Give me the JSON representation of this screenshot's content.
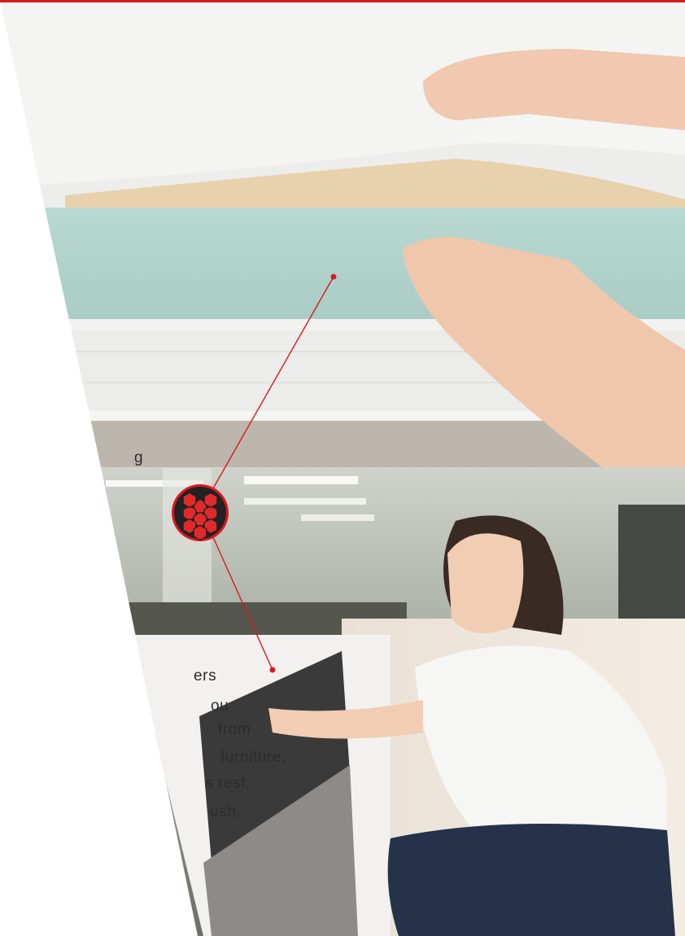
{
  "article": {
    "fragment_top": "g",
    "lines": [
      "ers",
      "ou",
      "from",
      "furniture.",
      "s rest,",
      "ush,"
    ]
  },
  "icons": {
    "callout_badge": "honeycomb-foam-icon"
  },
  "colors": {
    "accent": "#d71920",
    "badge_bg": "#222222",
    "cell_fill": "#e02a2a",
    "text": "#2b2b2b"
  }
}
